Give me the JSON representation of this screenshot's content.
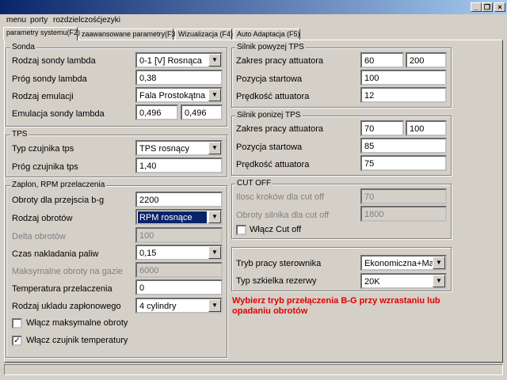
{
  "window": {
    "minimize_glyph": "_",
    "restore_glyph": "❐",
    "close_glyph": "×"
  },
  "menu": [
    "menu",
    "porty",
    "rozdzielczość",
    "jezyki"
  ],
  "tabs": [
    "parametry systemu(F2)",
    "zaawansowane parametry(F3)",
    "Wizualizacja (F4)",
    "Auto Adaptacja (F5)"
  ],
  "sonda": {
    "title": "Sonda",
    "rodzaj_label": "Rodzaj sondy lambda",
    "rodzaj_value": "0-1 [V]  Rosnąca",
    "prog_label": "Próg sondy lambda",
    "prog_value": "0,38",
    "emulacji_label": "Rodzaj emulacji",
    "emulacji_value": "Fala Prostokątna",
    "emulacja_label": "Emulacja sondy lambda",
    "emulacja_value1": "0,496",
    "emulacja_value2": "0,496"
  },
  "tps": {
    "title": "TPS",
    "typ_label": "Typ czujnika tps",
    "typ_value": "TPS rosnący",
    "prog_label": "Próg czujnika tps",
    "prog_value": "1,40"
  },
  "zaplon": {
    "title": "Zaplon, RPM przelaczenia",
    "obroty_label": "Obroty dla przejscia b-g",
    "obroty_value": "2200",
    "rodzaj_label": "Rodzaj obrotów",
    "rodzaj_value": "RPM rosnące",
    "delta_label": "Delta obrotów",
    "delta_value": "100",
    "czas_label": "Czas nakladania paliw",
    "czas_value": "0,15",
    "max_label": "Maksymalne obroty na gazie",
    "max_value": "6000",
    "temp_label": "Temperatura przelaczenia",
    "temp_value": "0",
    "uklad_label": "Rodzaj ukladu zapłonowego",
    "uklad_value": "4 cylindry",
    "chk_max_label": "Włącz maksymalne obroty",
    "chk_max_checked": false,
    "chk_temp_label": "Włącz czujnik temperatury",
    "chk_temp_checked": true
  },
  "silnik_powyzej": {
    "title": "Silnik powyzej TPS",
    "zakres_label": "Zakres pracy attuatora",
    "zakres_value1": "60",
    "zakres_value2": "200",
    "pozycja_label": "Pozycja startowa",
    "pozycja_value": "100",
    "predkosc_label": "Prędkość attuatora",
    "predkosc_value": "12"
  },
  "silnik_ponizej": {
    "title": "Silnik ponizej TPS",
    "zakres_label": "Zakres pracy attuatora",
    "zakres_value1": "70",
    "zakres_value2": "100",
    "pozycja_label": "Pozycja startowa",
    "pozycja_value": "85",
    "predkosc_label": "Prędkość attuatora",
    "predkosc_value": "75"
  },
  "cutoff": {
    "title": "CUT OFF",
    "krokow_label": "Ilosc kroków dla cut off",
    "krokow_value": "70",
    "obroty_label": "Obroty silnika dla cut off",
    "obroty_value": "1800",
    "chk_label": "Włącz Cut off",
    "chk_checked": false
  },
  "tryb": {
    "tryb_label": "Tryb pracy sterownika",
    "tryb_value": "Ekonomiczna+Max",
    "szkielko_label": "Typ szkielka rezerwy",
    "szkielko_value": "20K"
  },
  "warning": "Wybierz tryb przełączenia B-G przy wzrastaniu lub opadaniu obrotów",
  "colors": {
    "title_start": "#0a246a",
    "title_end": "#a6caf0",
    "warning": "#e00000",
    "selection": "#0a246a"
  }
}
